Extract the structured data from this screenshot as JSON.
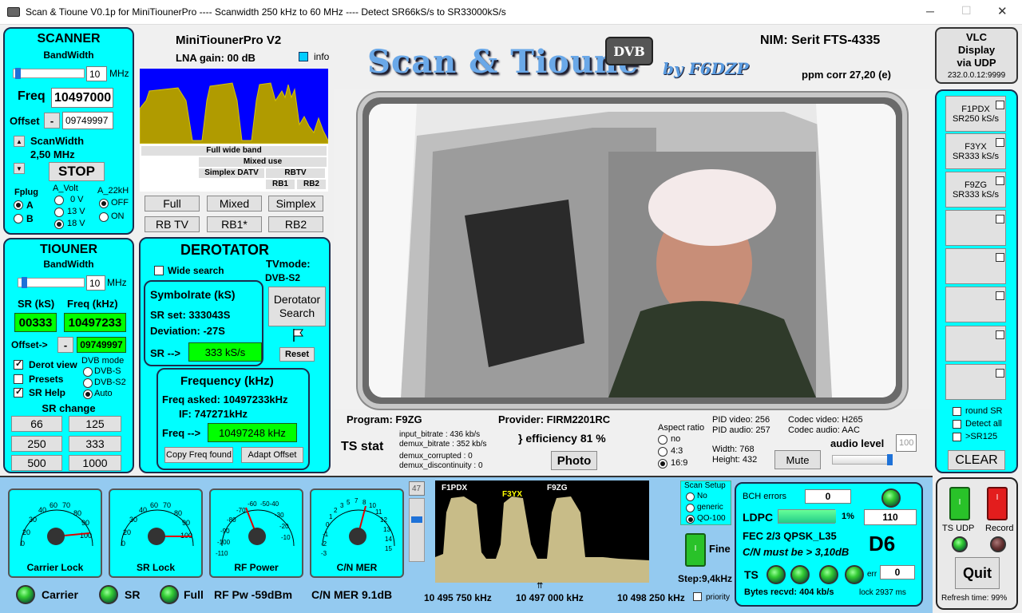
{
  "window": {
    "title": "Scan & Tioune V0.1p for MiniTiounerPro ---- Scanwidth 250 kHz to 60 MHz ---- Detect SR66kS/s to SR33000kS/s",
    "min": "─",
    "max": "☐",
    "close": "✕"
  },
  "scanner": {
    "title": "SCANNER",
    "bw_label": "BandWidth",
    "bw_value": "10",
    "mhz": "MHz",
    "freq_label": "Freq",
    "freq_value": "10497000",
    "offset_label": "Offset",
    "offset_sign": "-",
    "offset_value": "09749997",
    "scanwidth_label": "ScanWidth",
    "scanwidth_value": "2,50 MHz",
    "stop": "STOP",
    "fplug": "Fplug",
    "fplug_a": "A",
    "fplug_b": "B",
    "avolt": "A_Volt",
    "v0": "0 V",
    "v13": "13 V",
    "v18": "18 V",
    "a22": "A_22kH",
    "off": "OFF",
    "on": "ON"
  },
  "tiouner": {
    "title": "TIOUNER",
    "bw_label": "BandWidth",
    "bw_value": "10",
    "mhz": "MHz",
    "sr_label": "SR (kS)",
    "freq_label": "Freq (kHz)",
    "sr_value": "00333",
    "freq_value": "10497233",
    "offset_label": "Offset->",
    "offset_sign": "-",
    "offset_value": "09749997",
    "derot_view": "Derot view",
    "presets": "Presets",
    "sr_help": "SR Help",
    "dvb_mode": "DVB mode",
    "dvbs": "DVB-S",
    "dvbs2": "DVB-S2",
    "auto": "Auto",
    "sr_change": "SR change",
    "sr_buttons": [
      "66",
      "125",
      "250",
      "333",
      "500",
      "1000"
    ]
  },
  "mini": {
    "title": "MiniTiounerPro V2",
    "lna": "LNA gain: 00 dB",
    "info": "info",
    "band1": "Full wide band",
    "band2": "Mixed use",
    "band3a": "Simplex DATV",
    "band3b": "RBTV",
    "rb1": "RB1",
    "rb2": "RB2",
    "buttons": [
      "Full",
      "Mixed",
      "Simplex",
      "RB TV",
      "RB1*",
      "RB2"
    ]
  },
  "derot": {
    "title": "DEROTATOR",
    "wide": "Wide search",
    "tvmode": "TVmode:",
    "tvmode_val": "DVB-S2",
    "sym_title": "Symbolrate (kS)",
    "srset": "SR set:  333043S",
    "dev": "Deviation:  -27S",
    "sr_arrow": "SR -->",
    "sr_val": "333 kS/s",
    "search": "Derotator Search",
    "reset": "Reset",
    "freq_title": "Frequency (kHz)",
    "asked": "Freq asked:  10497233kHz",
    "if": "IF:      747271kHz",
    "freq_arrow": "Freq -->",
    "freq_val": "10497248 kHz",
    "copy": "Copy Freq found",
    "adapt": "Adapt Offset"
  },
  "header": {
    "logo": "Scan & Tioune",
    "dvb": "DVB",
    "by": "by F6DZP",
    "nim": "NIM:  Serit FTS-4335",
    "ppm": "ppm corr   27,20 (e)"
  },
  "vlc": {
    "l1": "VLC",
    "l2": "Display",
    "l3": "via UDP",
    "ip": "232.0.0.12:9999"
  },
  "stations": [
    {
      "n": "F1PDX",
      "s": "SR250 kS/s"
    },
    {
      "n": "F3YX",
      "s": "SR333 kS/s"
    },
    {
      "n": "F9ZG",
      "s": "SR333 kS/s"
    }
  ],
  "rightopts": {
    "round": "round SR",
    "detect": "Detect all",
    "gt": ">SR125",
    "clear": "CLEAR"
  },
  "stats": {
    "program": "Program: F9ZG",
    "provider": "Provider: FIRM2201RC",
    "ts": "TS stat",
    "ib": "input_bitrate :   436 kb/s",
    "db": "demux_bitrate :   352 kb/s",
    "dc": "demux_corrupted :  0",
    "dd": "demux_discontinuity :  0",
    "eff": "} efficiency  81 %",
    "photo": "Photo",
    "aspect": "Aspect ratio",
    "no": "no",
    "a43": "4:3",
    "a169": "16:9",
    "pidv": "PID video:  256",
    "pida": "PID audio:  257",
    "codv": "Codec video:  H265",
    "coda": "Codec audio:  AAC",
    "width": "Width:    768",
    "height": "Height:   432",
    "mute": "Mute",
    "audio": "audio level",
    "audio_val": "100"
  },
  "gauges": [
    {
      "t": "Carrier Lock",
      "ticks": [
        "0",
        "10",
        "20",
        "30",
        "40",
        "50",
        "60",
        "70",
        "80",
        "90",
        "100"
      ]
    },
    {
      "t": "SR Lock",
      "ticks": [
        "0",
        "10",
        "20",
        "30",
        "40",
        "50",
        "60",
        "70",
        "80",
        "90",
        "100"
      ]
    },
    {
      "t": "RF Power",
      "ticks": [
        "-110",
        "-100",
        "-90",
        "-80",
        "-70",
        "-60",
        "-50",
        "-40",
        "-30",
        "-20",
        "-10"
      ]
    },
    {
      "t": "C/N MER",
      "ticks": [
        "-3",
        "-2",
        "-1",
        "0",
        "1",
        "2",
        "3",
        "4",
        "5",
        "6",
        "7",
        "8",
        "9",
        "10",
        "11",
        "12",
        "13",
        "14",
        "15"
      ]
    }
  ],
  "bottom": {
    "carrier": "Carrier",
    "sr": "SR",
    "full": "Full",
    "rfpw": "RF Pw  -59dBm",
    "cnmer": "C/N MER 9.1dB"
  },
  "spectrum": {
    "level": "47",
    "l1": "F1PDX",
    "l2": "F3YX",
    "l3": "F9ZG",
    "f1": "10 495 750 kHz",
    "f2": "10 497 000 kHz",
    "f3": "10 498 250 kHz",
    "priority": "priority",
    "step": "Step:9,4kHz",
    "fine": "Fine",
    "scan_setup": "Scan Setup",
    "no": "No",
    "generic": "generic",
    "qo": "QO-100"
  },
  "decoder": {
    "bch": "BCH errors",
    "bch_val": "0",
    "ldpc": "LDPC",
    "ldpc_pct": "1%",
    "ldpc_val": "110",
    "fec": "FEC  2/3 QPSK_L35",
    "cn": "C/N must be > 3,10dB",
    "d6": "D6",
    "ts": "TS",
    "err": "err",
    "err_val": "0",
    "bytes": "Bytes recvd: 404 kb/s",
    "lock": "lock  2937 ms"
  },
  "far": {
    "tsudp": "TS UDP",
    "record": "Record",
    "quit": "Quit",
    "refresh": "Refresh time:  99%"
  }
}
